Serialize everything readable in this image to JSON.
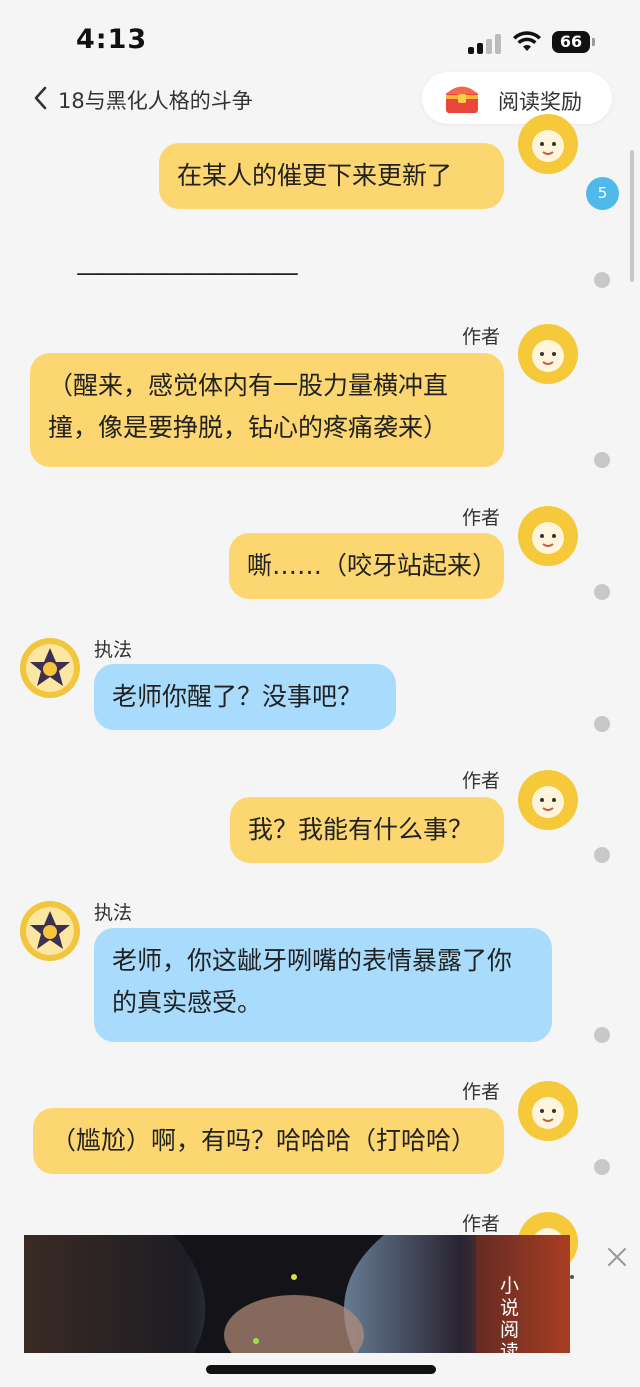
{
  "status_bar": {
    "time": "4:13",
    "battery": "66"
  },
  "nav": {
    "title": "18与黑化人格的斗争",
    "reward_label": "阅读奖励"
  },
  "unread_badge": "5",
  "divider": "——————————",
  "messages": [
    {
      "text": "在某人的催更下来更新了"
    },
    {
      "sender": "作者",
      "text": "（醒来，感觉体内有一股力量横冲直撞，像是要挣脱，钻心的疼痛袭来）"
    },
    {
      "sender": "作者",
      "text": "嘶……（咬牙站起来）"
    },
    {
      "sender": "执法",
      "text": "老师你醒了？没事吧？"
    },
    {
      "sender": "作者",
      "text": "我？我能有什么事？"
    },
    {
      "sender": "执法",
      "text": "老师，你这龇牙咧嘴的表情暴露了你的真实感受。"
    },
    {
      "sender": "作者",
      "text": "（尴尬）啊，有吗？哈哈哈（打哈哈）"
    },
    {
      "sender": "作者",
      "text": ""
    }
  ],
  "ad": {
    "text": "小说阅读"
  },
  "colors": {
    "author_bubble": "#fcd771",
    "other_bubble": "#a9dcfc",
    "badge": "#4fb9ea"
  },
  "icons": [
    "back-chevron-icon",
    "treasure-chest-icon",
    "signal-icon",
    "wifi-icon",
    "close-icon"
  ]
}
